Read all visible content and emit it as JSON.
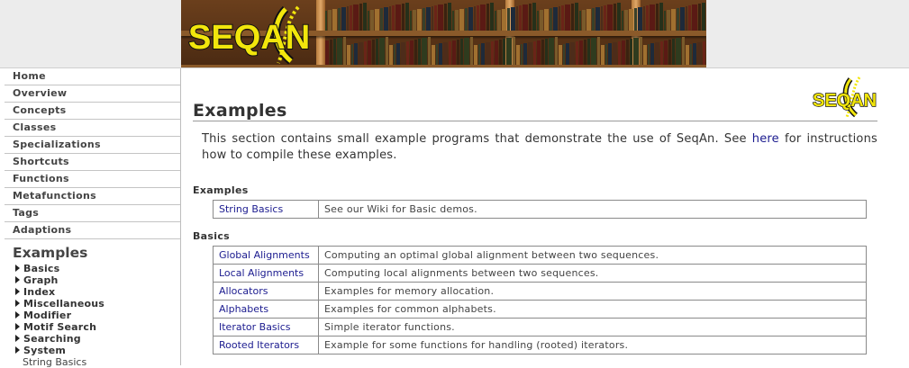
{
  "logo": {
    "text": "SEQAN"
  },
  "corner_logo": {
    "text": "SEQAN"
  },
  "sidebar": {
    "items": [
      {
        "label": "Home"
      },
      {
        "label": "Overview"
      },
      {
        "label": "Concepts"
      },
      {
        "label": "Classes"
      },
      {
        "label": "Specializations"
      },
      {
        "label": "Shortcuts"
      },
      {
        "label": "Functions"
      },
      {
        "label": "Metafunctions"
      },
      {
        "label": "Tags"
      },
      {
        "label": "Adaptions"
      }
    ],
    "current_heading": "Examples",
    "sub_items": [
      {
        "label": "Basics"
      },
      {
        "label": "Graph"
      },
      {
        "label": "Index"
      },
      {
        "label": "Miscellaneous"
      },
      {
        "label": "Modifier"
      },
      {
        "label": "Motif Search"
      },
      {
        "label": "Searching"
      },
      {
        "label": "System"
      }
    ],
    "current_leaf": "String Basics"
  },
  "main": {
    "title": "Examples",
    "intro_before": "This section contains small example programs that demonstrate the use of SeqAn. See ",
    "intro_link": "here",
    "intro_after": " for instructions how to compile these examples.",
    "sections": [
      {
        "heading": "Examples",
        "rows": [
          {
            "name": "String Basics",
            "description": "See our Wiki for Basic demos."
          }
        ]
      },
      {
        "heading": "Basics",
        "rows": [
          {
            "name": "Global Alignments",
            "description": "Computing an optimal global alignment between two sequences."
          },
          {
            "name": "Local Alignments",
            "description": "Computing local alignments between two sequences."
          },
          {
            "name": "Allocators",
            "description": "Examples for memory allocation."
          },
          {
            "name": "Alphabets",
            "description": "Examples for common alphabets."
          },
          {
            "name": "Iterator Basics",
            "description": "Simple iterator functions."
          },
          {
            "name": "Rooted Iterators",
            "description": "Example for some functions for handling (rooted) iterators."
          }
        ]
      }
    ]
  },
  "colors": {
    "link": "#1b1b8f",
    "logo_yellow": "#f2e60c",
    "banner_wood": "#6b3f1c"
  }
}
